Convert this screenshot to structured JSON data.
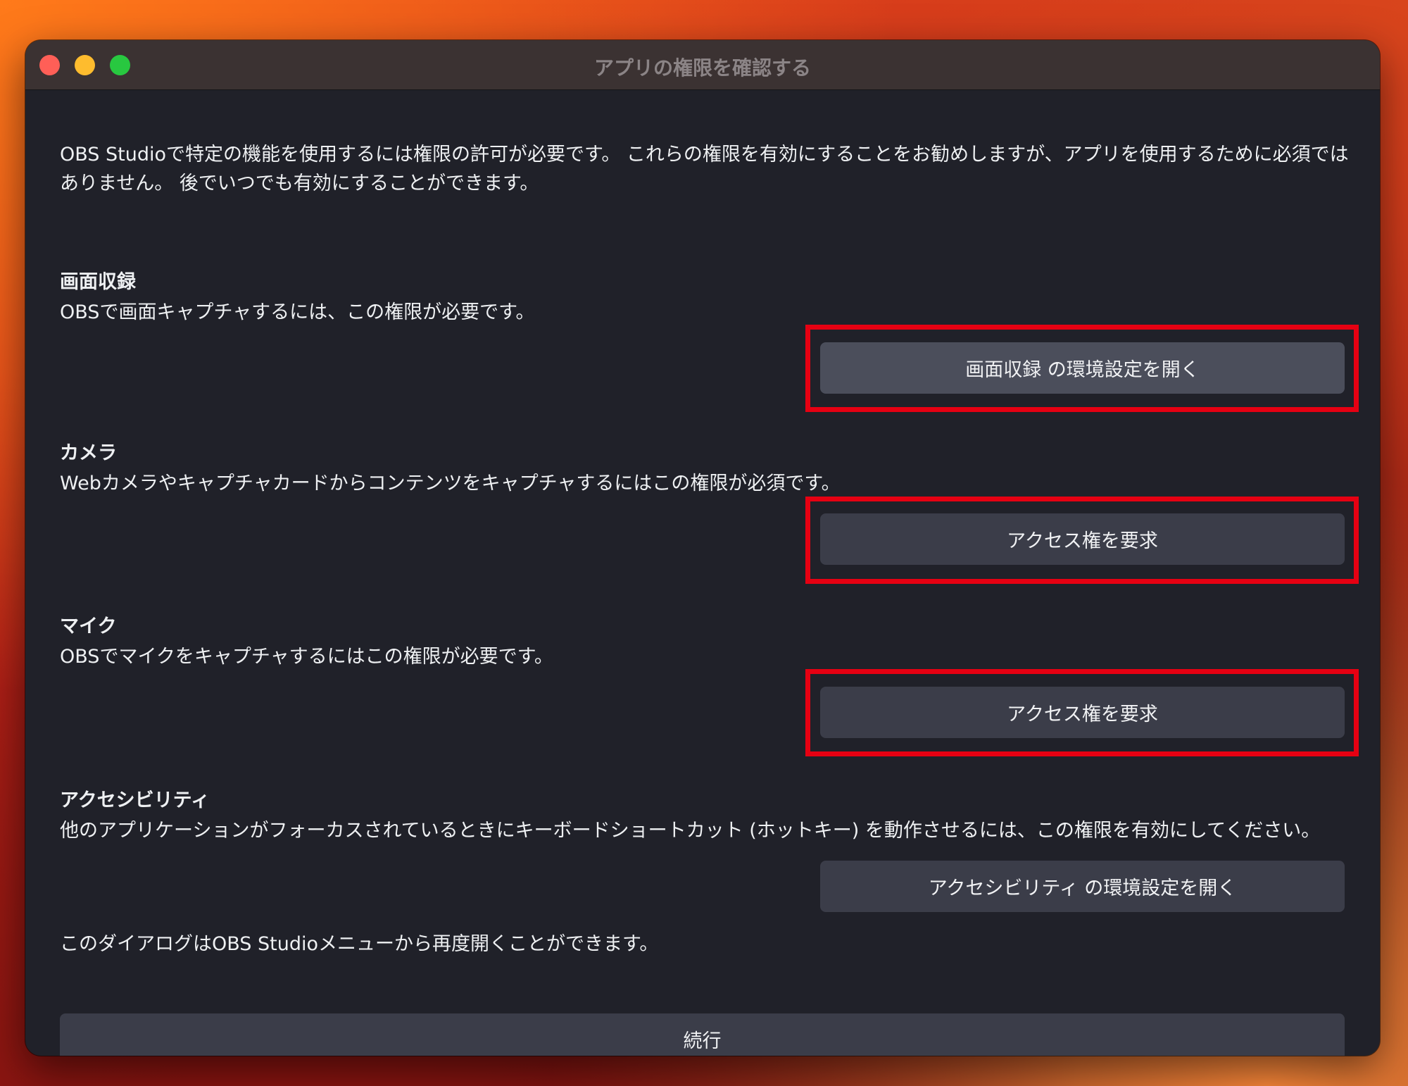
{
  "colors": {
    "highlight": "#e60012",
    "window_bg": "#202129",
    "button_bg": "#3b3d49"
  },
  "window": {
    "title": "アプリの権限を確認する",
    "controls": [
      "close",
      "minimize",
      "zoom"
    ]
  },
  "intro": "OBS Studioで特定の機能を使用するには権限の許可が必要です。 これらの権限を有効にすることをお勧めしますが、アプリを使用するために必須ではありません。 後でいつでも有効にすることができます。",
  "sections": [
    {
      "heading": "画面収録",
      "description": "OBSで画面キャプチャするには、この権限が必要です。",
      "button": "画面収録 の環境設定を開く",
      "highlighted": true
    },
    {
      "heading": "カメラ",
      "description": "Webカメラやキャプチャカードからコンテンツをキャプチャするにはこの権限が必須です。",
      "button": "アクセス権を要求",
      "highlighted": true
    },
    {
      "heading": "マイク",
      "description": "OBSでマイクをキャプチャするにはこの権限が必要です。",
      "button": "アクセス権を要求",
      "highlighted": true
    },
    {
      "heading": "アクセシビリティ",
      "description": "他のアプリケーションがフォーカスされているときにキーボードショートカット (ホットキー) を動作させるには、この権限を有効にしてください。",
      "button": "アクセシビリティ の環境設定を開く",
      "highlighted": false
    }
  ],
  "footer_note": "このダイアログはOBS Studioメニューから再度開くことができます。",
  "continue_button": "続行"
}
